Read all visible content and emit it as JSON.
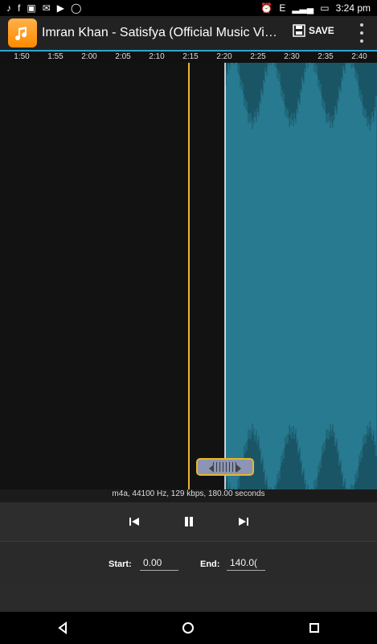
{
  "status_bar": {
    "time": "3:24 pm",
    "network": "E",
    "left_icons": [
      "music-note-icon",
      "f-icon",
      "gallery-icon",
      "email-icon",
      "play-icon",
      "circle-icon"
    ],
    "right_icons": [
      "alarm-icon",
      "signal-icon",
      "battery-icon"
    ]
  },
  "app_bar": {
    "title": "Imran Khan - Satisfya (Official Music Video) Rin..",
    "save_label": "SAVE"
  },
  "timeline": {
    "ticks": [
      "1:50",
      "1:55",
      "2:00",
      "2:05",
      "2:10",
      "2:15",
      "2:20",
      "2:25",
      "2:30",
      "2:35",
      "2:40"
    ]
  },
  "waveform_info": "m4a, 44100 Hz, 129 kbps, 180.00 seconds",
  "controls": {
    "prev_icon": "skip-previous-icon",
    "pause_icon": "pause-icon",
    "next_icon": "skip-next-icon"
  },
  "fields": {
    "start_label": "Start:",
    "start_value": "0.00",
    "end_label": "End:",
    "end_value": "140.0("
  },
  "nav": {
    "back_icon": "back-icon",
    "home_icon": "home-icon",
    "recent_icon": "recent-apps-icon"
  },
  "colors": {
    "accent": "#2aa7d1",
    "selected_wave": "#2f2fd0",
    "unselected_wave": "#1c5f73",
    "marker": "#e6b72c"
  }
}
